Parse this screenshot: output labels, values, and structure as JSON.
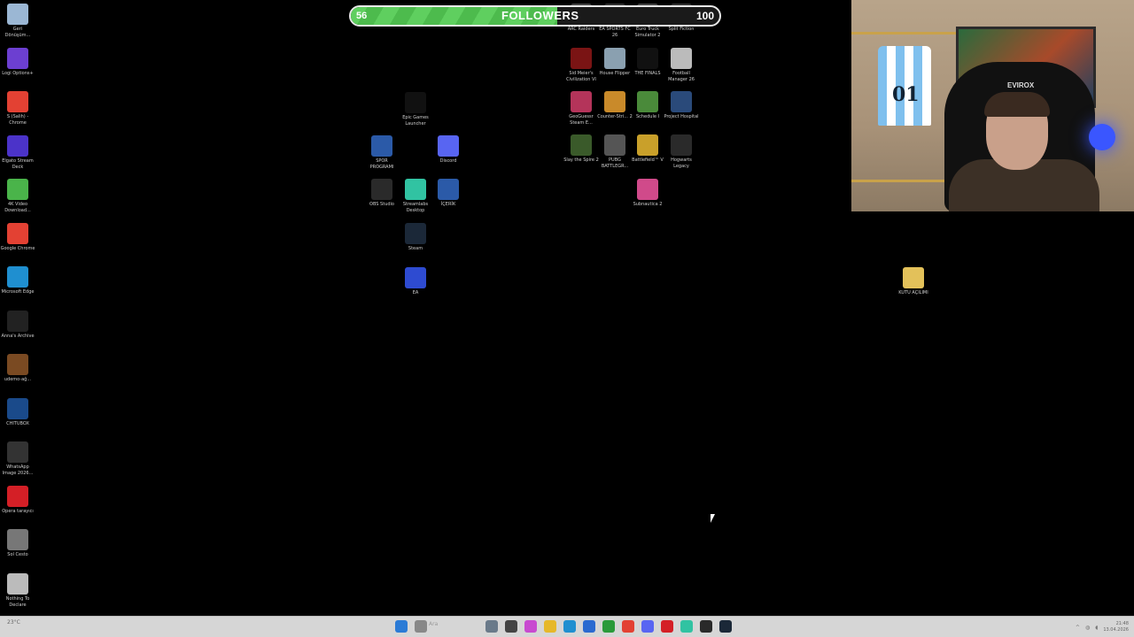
{
  "goal": {
    "start": "56",
    "title": "FOLLOWERS",
    "end": "100",
    "progress_fraction": 0.56
  },
  "desktop_left": [
    {
      "label": "Geri Dönüşüm...",
      "icon": "recycle-bin-icon",
      "color": "#9bb7d4"
    },
    {
      "label": "Logi Options+",
      "icon": "logi-options-icon",
      "color": "#6c3fd1"
    },
    {
      "label": "S (Salih) - Chrome",
      "icon": "chrome-icon",
      "color": "#e34133"
    },
    {
      "label": "Elgato Stream Deck",
      "icon": "stream-deck-icon",
      "color": "#4b33c9"
    },
    {
      "label": "4K Video Download...",
      "icon": "4k-video-icon",
      "color": "#4ab44a"
    },
    {
      "label": "Google Chrome",
      "icon": "chrome-icon",
      "color": "#e34133"
    },
    {
      "label": "Microsoft Edge",
      "icon": "edge-icon",
      "color": "#1f8fd0"
    },
    {
      "label": "Anna's Archive",
      "icon": "annas-archive-icon",
      "color": "#222222"
    },
    {
      "label": "udemo-ağ...",
      "icon": "image-file-icon",
      "color": "#7a4a22"
    },
    {
      "label": "CHITUBOX",
      "icon": "chitubox-icon",
      "color": "#1a4a8a"
    },
    {
      "label": "WhatsApp Image 2026...",
      "icon": "image-file-icon",
      "color": "#333333"
    },
    {
      "label": "Opera tarayıcı",
      "icon": "opera-icon",
      "color": "#d41f26"
    },
    {
      "label": "Sol Cesto",
      "icon": "sol-cesto-icon",
      "color": "#777777"
    },
    {
      "label": "Nothing To Declare",
      "icon": "nothing-to-declare-icon",
      "color": "#bbbbbb"
    }
  ],
  "desktop_mid": [
    {
      "label": "Epic Games Launcher",
      "icon": "epic-games-icon",
      "color": "#111111"
    },
    {
      "label": "SPOR PROGRAMI",
      "icon": "word-doc-icon",
      "color": "#2b5aa8"
    },
    {
      "label": "Discord",
      "icon": "discord-icon",
      "color": "#5865f2"
    },
    {
      "label": "OBS Studio",
      "icon": "obs-icon",
      "color": "#2a2a2a"
    },
    {
      "label": "Streamlabs Desktop",
      "icon": "streamlabs-icon",
      "color": "#31c3a2"
    },
    {
      "label": "İÇERİK",
      "icon": "word-doc-icon",
      "color": "#2b5aa8"
    },
    {
      "label": "Steam",
      "icon": "steam-icon",
      "color": "#1b2838"
    },
    {
      "label": "EA",
      "icon": "ea-icon",
      "color": "#2e4bd1"
    }
  ],
  "desktop_games": [
    {
      "label": "ARC Raiders",
      "icon": "arc-raiders-icon",
      "color": "#444444"
    },
    {
      "label": "EA SPORTS FC 26",
      "icon": "ea-fc-icon",
      "color": "#333333"
    },
    {
      "label": "Euro Truck Simulator 2",
      "icon": "ets2-icon",
      "color": "#444444"
    },
    {
      "label": "Split Fiction",
      "icon": "split-fiction-icon",
      "color": "#333333"
    },
    {
      "label": "Sid Meier's Civilization VI",
      "icon": "civ6-icon",
      "color": "#7a1414"
    },
    {
      "label": "House Flipper",
      "icon": "house-flipper-icon",
      "color": "#8aa0b0"
    },
    {
      "label": "THE FINALS",
      "icon": "the-finals-icon",
      "color": "#111111"
    },
    {
      "label": "Football Manager 26",
      "icon": "football-manager-icon",
      "color": "#bbbbbb"
    },
    {
      "label": "GeoGuessr Steam E...",
      "icon": "geoguessr-icon",
      "color": "#b4345a"
    },
    {
      "label": "Counter-Stri... 2",
      "icon": "cs2-icon",
      "color": "#c98a2a"
    },
    {
      "label": "Schedule I",
      "icon": "schedule-one-icon",
      "color": "#4a8a3a"
    },
    {
      "label": "Project Hospital",
      "icon": "project-hospital-icon",
      "color": "#2a4a7a"
    },
    {
      "label": "Slay the Spire 2",
      "icon": "slay-the-spire-icon",
      "color": "#3a5a2a"
    },
    {
      "label": "PUBG BATTLEGR...",
      "icon": "pubg-icon",
      "color": "#555555"
    },
    {
      "label": "Battlefield™ V",
      "icon": "battlefield-icon",
      "color": "#c9a02a"
    },
    {
      "label": "Hogwarts Legacy",
      "icon": "hogwarts-icon",
      "color": "#2a2a2a"
    },
    {
      "label": "Subnautica 2",
      "icon": "subnautica-icon",
      "color": "#d04a8a"
    }
  ],
  "desktop_right": [
    {
      "label": "KUTU AÇILIMI",
      "icon": "folder-icon",
      "color": "#e3c15a"
    }
  ],
  "webcam": {
    "chair_brand": "EVIROX",
    "jersey_number": "01"
  },
  "taskbar": {
    "weather": "23°C",
    "search_placeholder": "Ara",
    "clock_time": "21:48",
    "clock_date": "13.04.2026",
    "icons": [
      {
        "icon": "start-icon",
        "color": "#2b7bd6"
      },
      {
        "icon": "search-icon",
        "color": "#888888"
      },
      {
        "icon": "widgets-icon",
        "color": "#6a7a8a"
      },
      {
        "icon": "task-view-icon",
        "color": "#444444"
      },
      {
        "icon": "copilot-icon",
        "color": "#c84ad0"
      },
      {
        "icon": "file-explorer-icon",
        "color": "#e6b82a"
      },
      {
        "icon": "edge-icon",
        "color": "#1f8fd0"
      },
      {
        "icon": "store-icon",
        "color": "#2a6ad0"
      },
      {
        "icon": "xbox-icon",
        "color": "#2a9a3a"
      },
      {
        "icon": "chrome-icon",
        "color": "#e34133"
      },
      {
        "icon": "discord-icon",
        "color": "#5865f2"
      },
      {
        "icon": "opera-icon",
        "color": "#d41f26"
      },
      {
        "icon": "streamlabs-icon",
        "color": "#31c3a2"
      },
      {
        "icon": "obs-icon",
        "color": "#2a2a2a"
      },
      {
        "icon": "steam-icon",
        "color": "#1b2838"
      }
    ]
  }
}
